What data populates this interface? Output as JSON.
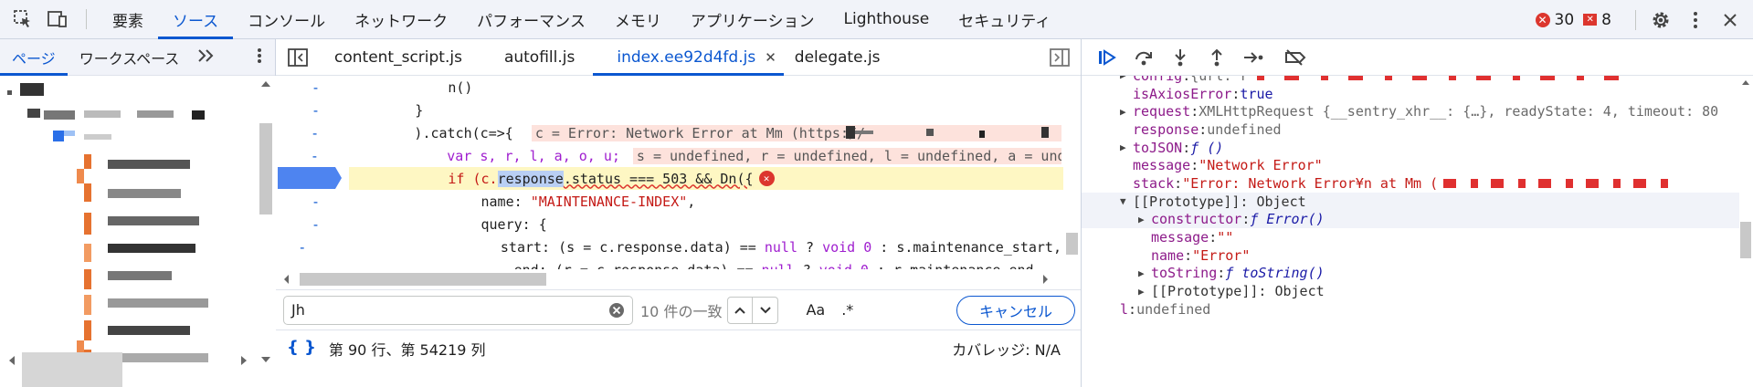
{
  "topbar": {
    "tabs": [
      "要素",
      "ソース",
      "コンソール",
      "ネットワーク",
      "パフォーマンス",
      "メモリ",
      "アプリケーション",
      "Lighthouse",
      "セキュリティ"
    ],
    "active_tab": "ソース",
    "error_count": "30",
    "warning_count": "8"
  },
  "navigator": {
    "tabs": [
      "ページ",
      "ワークスペース"
    ]
  },
  "editor": {
    "file_tabs": [
      "content_script.js",
      "autofill.js",
      "index.ee92d4fd.js",
      "delegate.js"
    ],
    "active_file": "index.ee92d4fd.js",
    "lines": {
      "l1": "            n()",
      "l2": "        }",
      "l3": "        ).catch(c=>{",
      "l3_inline": "c = Error: Network Error at Mm (https://",
      "l4_code": "            var s, r, l, a, o, u;",
      "l4_inline": "s = undefined, r = undefined, l = undefined, a = unde",
      "l5_pre": "            if (c.",
      "l5_sel": "response",
      "l5_post": ".status === 503 && ",
      "l5_tail": "Dn({",
      "l6_pre": "                name: ",
      "l6_str": "\"MAINTENANCE-INDEX\"",
      "l6_post": ",",
      "l7": "                query: {",
      "l8_pre": "                    start: (s = c.response.data) == ",
      "l8_null": "null",
      "l8_mid": " ? ",
      "l8_void": "void 0",
      "l8_post": " : s.maintenance_start,",
      "l9_pre": "                    end: (r = c.response.data) == ",
      "l9_null": "null",
      "l9_mid": " ? ",
      "l9_void": "void 0",
      "l9_post": " : r.maintenance_end",
      "gutter_mark": "-"
    },
    "search": {
      "value": "Jh",
      "match_text": "10 件の一致",
      "case_option": "Aa",
      "regex_option": ".*",
      "cancel_label": "キャンセル"
    },
    "status": {
      "position": "第 90 行、第 54219 列",
      "coverage": "カバレッジ: N/A",
      "braces": "{ }"
    }
  },
  "scope": {
    "config_prop": "config",
    "config_val": "{url: r",
    "isAxiosError_prop": "isAxiosError",
    "isAxiosError_val": "true",
    "request_prop": "request",
    "request_val": "XMLHttpRequest {__sentry_xhr__: {…}, readyState: 4, timeout: 80",
    "response_prop": "response",
    "response_val": "undefined",
    "toJSON_prop": "toJSON",
    "toJSON_val": "ƒ ()",
    "message_prop": "message",
    "message_val": "\"Network Error\"",
    "stack_prop": "stack",
    "stack_val": "\"Error: Network Error¥n    at Mm (",
    "proto_label": "[[Prototype]]: Object",
    "constructor_prop": "constructor",
    "constructor_val": "ƒ Error()",
    "message2_prop": "message",
    "message2_val": "\"\"",
    "name_prop": "name",
    "name_val": "\"Error\"",
    "toString_prop": "toString",
    "toString_val": "ƒ toString()",
    "proto2_label": "[[Prototype]]: Object",
    "l_prop": "l",
    "l_val": "undefined"
  },
  "colors": {
    "accent": "#0b57d0",
    "error": "#dc362e",
    "highlight_line": "#fef7c3",
    "inline_value_bg": "#fde2dc",
    "redacted": "#e03030"
  }
}
